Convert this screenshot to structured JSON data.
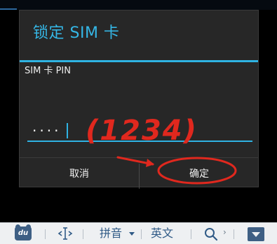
{
  "dialog": {
    "title": "锁定 SIM 卡",
    "field_label": "SIM 卡 PIN",
    "pin_masked": "····",
    "cancel_label": "取消",
    "ok_label": "确定"
  },
  "annotation": {
    "handwritten_text": "(1234)",
    "color": "#e0281e"
  },
  "ime_toolbar": {
    "logo_text": "du",
    "pinyin_label": "拼音",
    "english_label": "英文",
    "more_symbol": "›"
  },
  "colors": {
    "accent": "#2fb3e3",
    "title": "#35b7e6",
    "dialog_bg": "#272727",
    "ime_blue": "#2f5a86"
  }
}
